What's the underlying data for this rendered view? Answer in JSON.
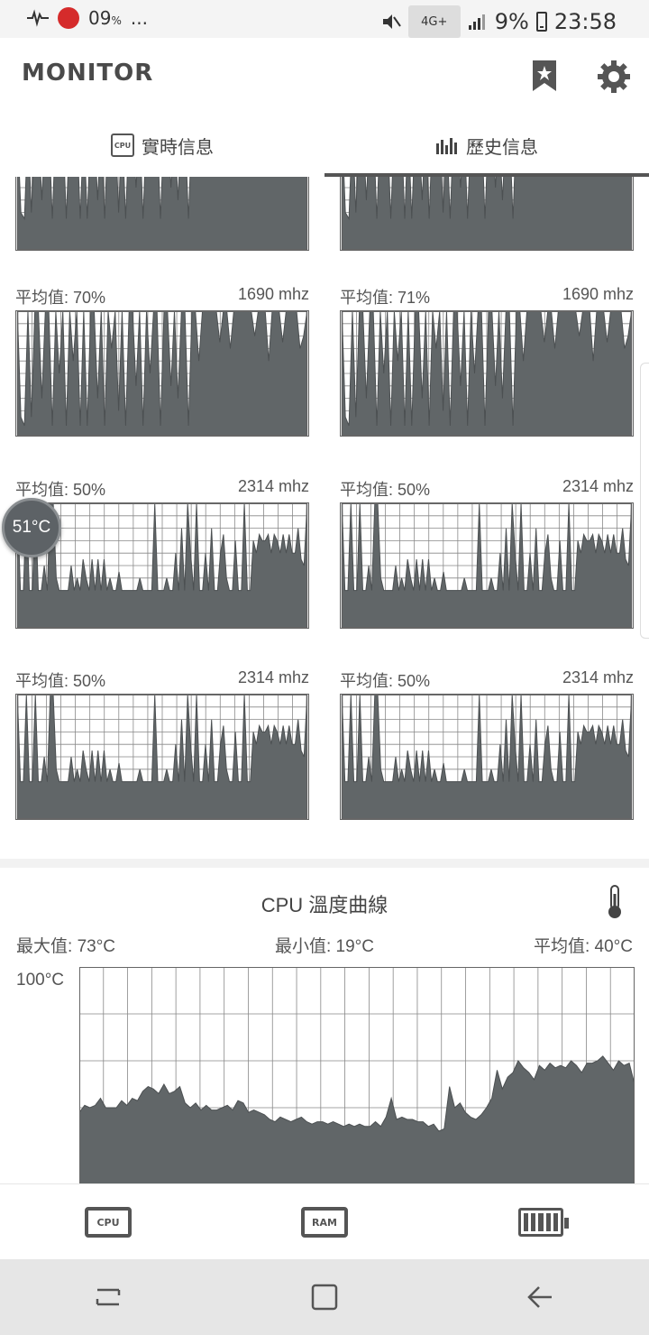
{
  "status_bar": {
    "battery_small_text": "09",
    "battery_small_unit": "%",
    "more": "...",
    "network": "4G+",
    "battery_text": "9%",
    "time": "23:58"
  },
  "app": {
    "title": "MONITOR"
  },
  "tabs": [
    {
      "label": "實時信息",
      "icon": "cpu-chip-icon",
      "active": false
    },
    {
      "label": "歷史信息",
      "icon": "bar-chart-icon",
      "active": true
    }
  ],
  "cores": [
    {
      "avg_label": "平均值:",
      "avg": "70%",
      "freq": "1690 mhz",
      "pattern": "a"
    },
    {
      "avg_label": "平均值:",
      "avg": "71%",
      "freq": "1690 mhz",
      "pattern": "a"
    },
    {
      "avg_label": "平均值:",
      "avg": "50%",
      "freq": "2314 mhz",
      "pattern": "b"
    },
    {
      "avg_label": "平均值:",
      "avg": "50%",
      "freq": "2314 mhz",
      "pattern": "b"
    },
    {
      "avg_label": "平均值:",
      "avg": "50%",
      "freq": "2314 mhz",
      "pattern": "b"
    },
    {
      "avg_label": "平均值:",
      "avg": "50%",
      "freq": "2314 mhz",
      "pattern": "b"
    }
  ],
  "core_series": {
    "a": [
      100,
      15,
      8,
      100,
      15,
      100,
      100,
      30,
      100,
      100,
      8,
      100,
      50,
      100,
      8,
      100,
      60,
      100,
      8,
      100,
      8,
      100,
      100,
      30,
      100,
      8,
      100,
      70,
      100,
      20,
      100,
      8,
      100,
      100,
      40,
      100,
      8,
      100,
      50,
      100,
      100,
      8,
      100,
      100,
      40,
      100,
      30,
      100,
      100,
      8,
      100,
      100,
      60,
      100,
      100,
      100,
      100,
      100,
      75,
      100,
      100,
      70,
      100,
      100,
      100,
      100,
      100,
      100,
      80,
      100,
      100,
      100,
      60,
      100,
      100,
      100,
      75,
      100,
      100,
      100,
      100,
      70,
      80,
      100
    ],
    "b": [
      100,
      30,
      30,
      100,
      30,
      30,
      100,
      30,
      30,
      50,
      30,
      100,
      100,
      40,
      30,
      30,
      30,
      30,
      50,
      30,
      40,
      30,
      55,
      40,
      30,
      55,
      30,
      55,
      30,
      55,
      30,
      40,
      30,
      30,
      45,
      30,
      30,
      30,
      30,
      30,
      30,
      40,
      30,
      30,
      30,
      30,
      100,
      30,
      30,
      30,
      40,
      30,
      30,
      60,
      30,
      80,
      30,
      100,
      60,
      30,
      100,
      30,
      30,
      60,
      30,
      80,
      30,
      30,
      60,
      75,
      40,
      30,
      30,
      70,
      30,
      30,
      100,
      30,
      30,
      70,
      60,
      75,
      70,
      70,
      75,
      60,
      75,
      70,
      60,
      75,
      60,
      75,
      60,
      60,
      80,
      55,
      50,
      100
    ]
  },
  "top_partial_series": [
    100,
    30,
    25,
    100,
    30,
    100,
    100,
    40,
    100,
    100,
    25,
    100,
    60,
    100,
    25,
    100,
    70,
    100,
    25,
    100,
    25,
    100,
    100,
    40,
    100,
    25,
    100,
    80,
    100,
    30,
    100,
    25,
    100,
    100,
    50,
    100,
    25,
    100,
    60,
    100,
    100,
    25,
    100,
    100,
    50,
    100,
    40,
    100,
    100,
    25,
    100,
    100,
    70,
    100,
    100,
    100,
    100,
    100,
    85,
    100,
    100,
    80,
    100,
    100,
    100,
    100,
    100,
    100,
    90,
    100,
    100,
    100,
    70,
    100,
    100,
    100,
    85,
    100,
    100,
    100,
    100,
    80,
    90,
    100
  ],
  "temperature": {
    "title": "CPU 溫度曲線",
    "max_label": "最大值:",
    "max": "73°C",
    "min_label": "最小值:",
    "min": "19°C",
    "avg_label": "平均值:",
    "avg": "40°C",
    "axis_max": "100°C",
    "badge": "51°C",
    "series_ylim": [
      0,
      100
    ],
    "series": [
      38,
      41,
      40,
      41,
      44,
      40,
      40,
      40,
      43,
      41,
      44,
      43,
      47,
      49,
      48,
      46,
      50,
      46,
      47,
      49,
      42,
      40,
      42,
      39,
      41,
      39,
      39,
      40,
      41,
      39,
      43,
      42,
      38,
      39,
      38,
      37,
      35,
      34,
      36,
      35,
      34,
      35,
      36,
      34,
      33,
      34,
      34,
      33,
      34,
      33,
      32,
      33,
      32,
      33,
      32,
      32,
      34,
      32,
      36,
      44,
      35,
      36,
      35,
      35,
      34,
      34,
      32,
      33,
      30,
      31,
      49,
      40,
      42,
      38,
      36,
      35,
      37,
      40,
      44,
      56,
      48,
      53,
      55,
      60,
      57,
      55,
      52,
      58,
      56,
      59,
      57,
      58,
      57,
      60,
      58,
      55,
      59,
      59,
      60,
      62,
      59,
      56,
      60,
      58,
      59,
      50
    ]
  },
  "bottom_nav": [
    {
      "label": "CPU",
      "icon": "cpu-icon"
    },
    {
      "label": "RAM",
      "icon": "ram-icon"
    },
    {
      "label": "",
      "icon": "battery-icon"
    }
  ],
  "system_nav": [
    "recents-icon",
    "home-icon",
    "back-icon"
  ]
}
